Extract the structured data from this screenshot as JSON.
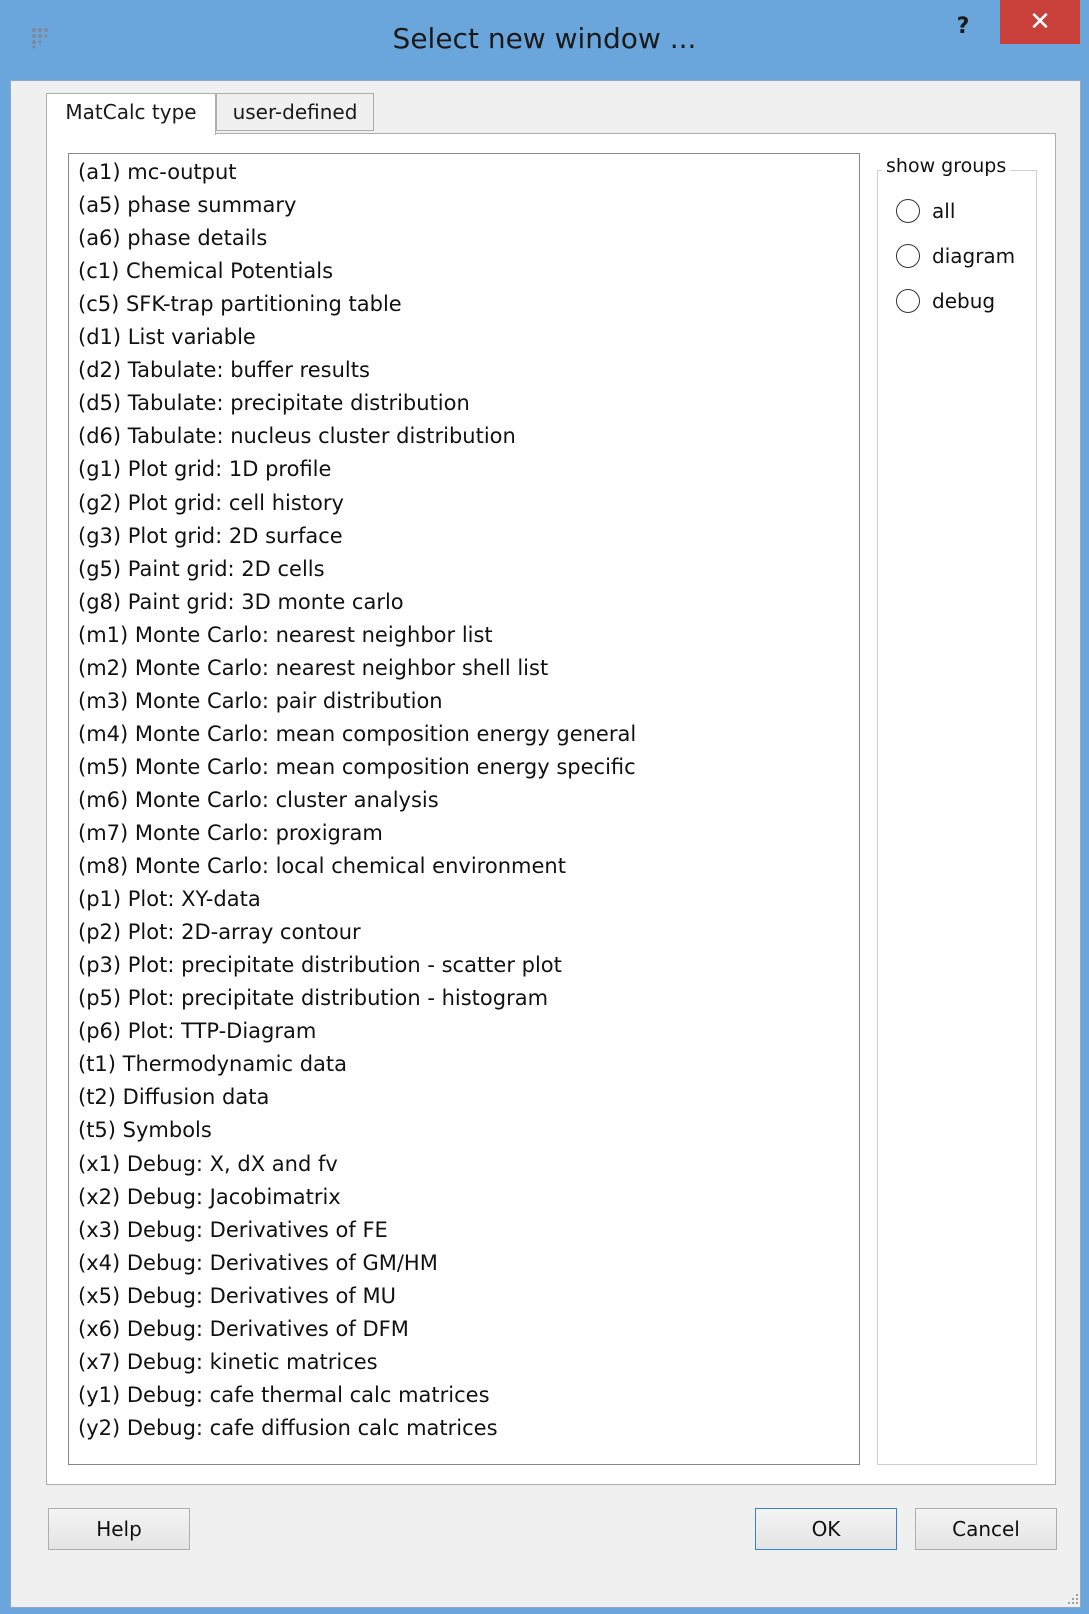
{
  "window": {
    "title": "Select new window ...",
    "help_label": "?",
    "close_label": "✕"
  },
  "tabs": [
    {
      "label": "MatCalc type",
      "active": true
    },
    {
      "label": "user-defined",
      "active": false
    }
  ],
  "list": {
    "items": [
      "(a1)  mc-output",
      "(a5)  phase summary",
      "(a6)  phase details",
      "(c1)  Chemical Potentials",
      "(c5)  SFK-trap partitioning table",
      "(d1)  List variable",
      "(d2)  Tabulate: buffer results",
      "(d5)  Tabulate: precipitate distribution",
      "(d6)  Tabulate: nucleus cluster distribution",
      "(g1)  Plot grid: 1D profile",
      "(g2)  Plot grid: cell history",
      "(g3)  Plot grid: 2D surface",
      "(g5)  Paint grid: 2D cells",
      "(g8)  Paint grid: 3D monte carlo",
      "(m1)  Monte Carlo: nearest neighbor list",
      "(m2)  Monte Carlo: nearest neighbor shell list",
      "(m3)  Monte Carlo: pair distribution",
      "(m4)  Monte Carlo: mean composition energy general",
      "(m5)  Monte Carlo: mean composition energy specific",
      "(m6)  Monte Carlo: cluster analysis",
      "(m7)  Monte Carlo: proxigram",
      "(m8)  Monte Carlo: local chemical environment",
      "(p1)  Plot: XY-data",
      "(p2)  Plot: 2D-array contour",
      "(p3)  Plot: precipitate distribution - scatter plot",
      "(p5)  Plot: precipitate distribution - histogram",
      "(p6)  Plot: TTP-Diagram",
      "(t1)  Thermodynamic data",
      "(t2)  Diffusion data",
      "(t5)  Symbols",
      "(x1)  Debug: X, dX and fv",
      "(x2)  Debug: Jacobimatrix",
      "(x3)  Debug: Derivatives of FE",
      "(x4)  Debug: Derivatives of GM/HM",
      "(x5)  Debug: Derivatives of MU",
      "(x6)  Debug: Derivatives of DFM",
      "(x7)  Debug: kinetic matrices",
      "(y1)  Debug: cafe thermal calc matrices",
      "(y2)  Debug: cafe diffusion calc matrices"
    ]
  },
  "show_groups": {
    "title": "show groups",
    "options": [
      {
        "label": "all",
        "checked": false
      },
      {
        "label": "diagram",
        "checked": false
      },
      {
        "label": "debug",
        "checked": false
      }
    ]
  },
  "buttons": {
    "help": "Help",
    "ok": "OK",
    "cancel": "Cancel"
  },
  "colors": {
    "titlebar": "#6aa6dc",
    "close": "#c9403a",
    "default_button_border": "#3c7fd1"
  }
}
